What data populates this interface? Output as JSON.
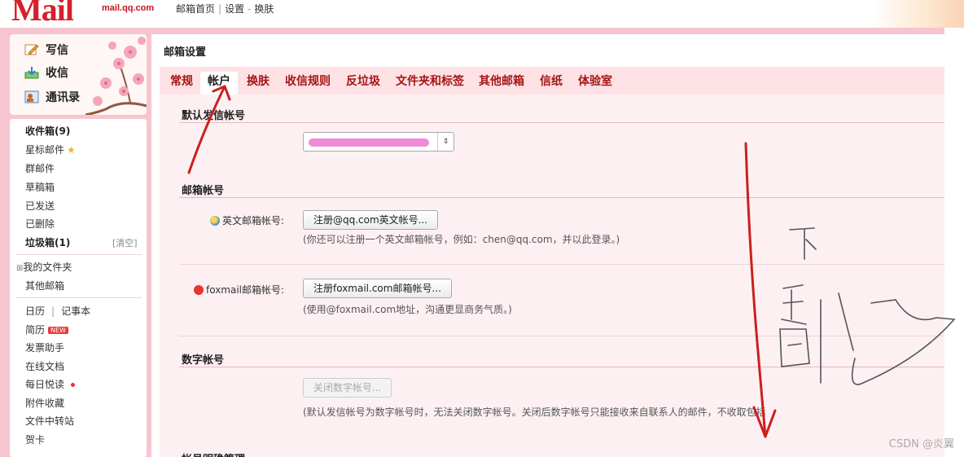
{
  "topbar": {
    "logo_text": "Mail",
    "logo_sub": "mail.qq.com",
    "links": [
      "邮箱首页",
      "设置",
      "换肤"
    ],
    "sep1": "|",
    "sep2": "-"
  },
  "quick_actions": [
    {
      "label": "写信",
      "icon": "pencil-icon"
    },
    {
      "label": "收信",
      "icon": "inbox-download-icon"
    },
    {
      "label": "通讯录",
      "icon": "contacts-icon"
    }
  ],
  "sidebar": {
    "folders": [
      {
        "label": "收件箱(9)"
      },
      {
        "label": "星标邮件"
      },
      {
        "label": "群邮件"
      },
      {
        "label": "草稿箱"
      },
      {
        "label": "已发送"
      },
      {
        "label": "已删除"
      },
      {
        "label": "垃圾箱(1)"
      }
    ],
    "clear_label": "[清空]",
    "my_folders": "我的文件夹",
    "my_folders_toggle": "⊞",
    "other_mailbox": "其他邮箱",
    "apps": {
      "calendar": "日历",
      "calendar_sep": "|",
      "notes": "记事本",
      "resume": "简历",
      "resume_badge": "NEW",
      "invoice": "发票助手",
      "docs": "在线文档",
      "daily_read": "每日悦读",
      "attachments": "附件收藏",
      "transfer": "文件中转站",
      "cards": "贺卡"
    }
  },
  "main": {
    "title": "邮箱设置",
    "tabs": [
      "常规",
      "帐户",
      "换肤",
      "收信规则",
      "反垃圾",
      "文件夹和标签",
      "其他邮箱",
      "信纸",
      "体验室"
    ],
    "active_tab": "帐户",
    "sections": {
      "default_sender": {
        "title": "默认发信帐号",
        "select_arrow": "⇕"
      },
      "mailbox_account": {
        "title": "邮箱帐号",
        "english_label": "英文邮箱帐号:",
        "english_button": "注册@qq.com英文帐号...",
        "english_hint": "(你还可以注册一个英文邮箱帐号，例如：chen@qq.com，并以此登录。)",
        "foxmail_label": "foxmail邮箱帐号:",
        "foxmail_button": "注册foxmail.com邮箱帐号...",
        "foxmail_hint": "(使用@foxmail.com地址，沟通更显商务气质。)"
      },
      "numeric_account": {
        "title": "数字帐号",
        "button": "关闭数字帐号...",
        "hint": "(默认发信帐号为数字帐号时，无法关闭数字帐号。关闭后数字帐号只能接收来自联系人的邮件，不收取包括"
      },
      "next_section_title": "帐号明确管理"
    }
  },
  "watermark": "CSDN @炎翼",
  "colors": {
    "frame_pink": "#f6c5cf",
    "tab_text": "#a31515",
    "annotation_red": "#cc1f1f"
  }
}
